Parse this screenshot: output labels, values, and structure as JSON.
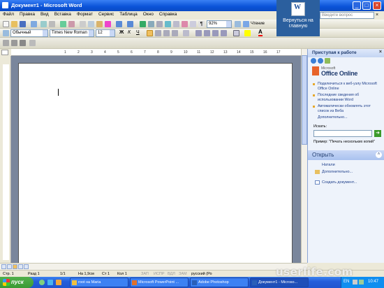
{
  "window": {
    "title": "Документ1 - Microsoft Word"
  },
  "menu": {
    "items": [
      "Файл",
      "Правка",
      "Вид",
      "Вставка",
      "Формат",
      "Сервис",
      "Таблица",
      "Окно",
      "Справка"
    ],
    "help_placeholder": "Введите вопрос"
  },
  "toolbar": {
    "zoom": "92%",
    "reading_label": "Чтение",
    "style": "Обычный",
    "font": "Times New Roman",
    "size": "12",
    "bold": "Ж",
    "italic": "К",
    "underline": "Ч"
  },
  "overlay": {
    "return_label": "Вернуться на главную",
    "icon": "W"
  },
  "taskpane": {
    "title": "Приступая к работе",
    "online_brand": "Microsoft",
    "online_name": "Office Online",
    "bullets": [
      "Подключиться к веб-узлу Microsoft Office Online",
      "Последние сведения об использовании Word",
      "Автоматически обновлять этот список из Веба"
    ],
    "more_link": "Дополнительно...",
    "search_label": "Искать:",
    "example_prefix": "Пример:",
    "example_text": "\"Печать нескольких копий\"",
    "open_header": "Открыть",
    "open_items": [
      "Натали",
      "Дополнительно..."
    ],
    "create_link": "Создать документ..."
  },
  "status": {
    "page": "Стр. 1",
    "section": "Разд 1",
    "pages": "1/1",
    "position": "На 1,9см",
    "line": "Ст 1",
    "col": "Кол 1",
    "rec": "ЗАП",
    "trk": "ИСПР",
    "ext": "ВДЛ",
    "ovr": "ЗАМ",
    "language": "русский (Ро"
  },
  "taskbar": {
    "start": "пуск",
    "buttons": [
      "root на Maria",
      "Microsoft PowerPoint ...",
      "Adobe Photoshop",
      "Документ1 - Microso..."
    ],
    "lang": "EN",
    "clock": "10:47"
  },
  "watermark": "userlife.com",
  "ruler_marks": [
    "1",
    "2",
    "3",
    "4",
    "5",
    "6",
    "7",
    "8",
    "9",
    "10",
    "11",
    "12",
    "13",
    "14",
    "15",
    "16",
    "17"
  ]
}
